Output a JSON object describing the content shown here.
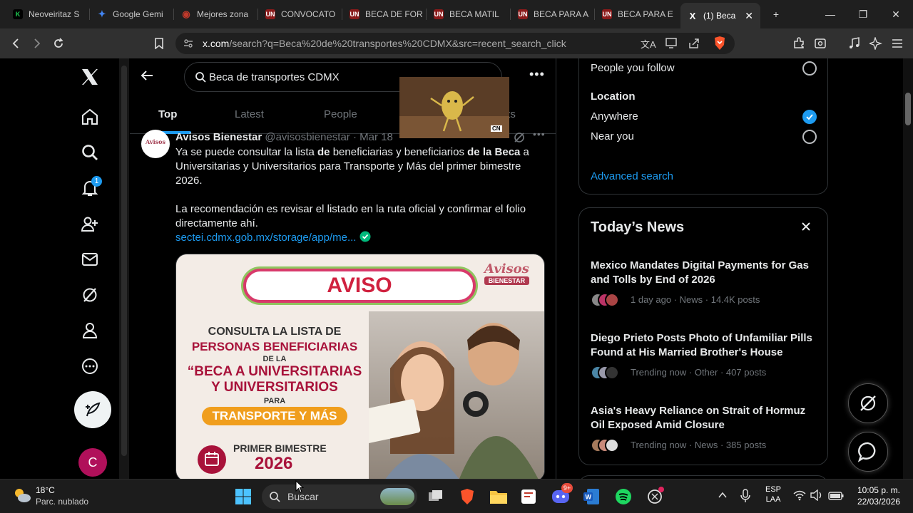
{
  "browser": {
    "tabs": [
      {
        "label": "Neoveiritaz S",
        "favicon": "K",
        "color": "#1fd155"
      },
      {
        "label": "Google Gemi",
        "favicon": "✦",
        "color": "#4285f4"
      },
      {
        "label": "Mejores zona",
        "favicon": "◉",
        "color": "#c0392b"
      },
      {
        "label": "CONVOCATO",
        "favicon": "UN",
        "color": "#8b1a1a"
      },
      {
        "label": "BECA DE FOR",
        "favicon": "UN",
        "color": "#8b1a1a"
      },
      {
        "label": "BECA MATIL",
        "favicon": "UN",
        "color": "#8b1a1a"
      },
      {
        "label": "BECA PARA A",
        "favicon": "UN",
        "color": "#8b1a1a"
      },
      {
        "label": "BECA PARA E",
        "favicon": "UN",
        "color": "#8b1a1a"
      }
    ],
    "active_tab": {
      "label": "(1) Beca",
      "favicon": "X"
    },
    "url_domain": "x.com",
    "url_path": "/search?q=Beca%20de%20transportes%20CDMX&src=recent_search_click"
  },
  "search": {
    "query": "Beca de transportes CDMX",
    "tabs": [
      "Top",
      "Latest",
      "People",
      "Lists"
    ],
    "active_tab": "Top"
  },
  "nav": {
    "notification_count": "1",
    "avatar_letter": "C"
  },
  "tweet": {
    "author": "Avisos Bienestar",
    "handle": "@avisosbienestar",
    "date": "Mar 18",
    "line1_pre": "Ya se puede consultar la lista ",
    "line1_b1": "de",
    "line1_mid": " beneficiarias y beneficiarios ",
    "line1_b2": "de",
    "line1_sp": " ",
    "line1_b3": "la",
    "line1_sp2": " ",
    "line1_b4": "Beca",
    "line1_post": " a Universitarias y Universitarios para Transporte y Más del primer bimestre 2026.",
    "para2": "La recomendación es revisar el listado en la ruta oficial y confirmar el folio directamente ahí.",
    "link": "sectei.cdmx.gob.mx/storage/app/me...",
    "image": {
      "brand_top": "Avisos",
      "brand_bottom": "BIENESTAR",
      "aviso": "AVISO",
      "consulta": "CONSULTA LA LISTA DE",
      "personas": "PERSONAS BENEFICIARIAS",
      "dela": "DE LA",
      "beca1": "“BECA A UNIVERSITARIAS",
      "beca2": "Y UNIVERSITARIOS",
      "para": "PARA",
      "transporte": "TRANSPORTE Y MÁS",
      "primer": "PRIMER BIMESTRE",
      "year": "2026"
    },
    "video_badge": "CN"
  },
  "filters": {
    "people_label": "People you follow",
    "location_heading": "Location",
    "anywhere": "Anywhere",
    "near_you": "Near you",
    "advanced": "Advanced search"
  },
  "news": {
    "heading": "Today’s News",
    "items": [
      {
        "title": "Mexico Mandates Digital Payments for Gas and Tolls by End of 2026",
        "meta": "1 day ago · News · 14.4K posts"
      },
      {
        "title": "Diego Prieto Posts Photo of Unfamiliar Pills Found at His Married Brother's House",
        "meta": "Trending now · Other · 407 posts"
      },
      {
        "title": "Asia's Heavy Reliance on Strait of Hormuz Oil Exposed Amid Closure",
        "meta": "Trending now · News · 385 posts"
      }
    ]
  },
  "taskbar": {
    "temp": "18°C",
    "weather": "Parc. nublado",
    "search": "Buscar",
    "discord_badge": "9+",
    "lang1": "ESP",
    "lang2": "LAA",
    "time": "10:05 p. m.",
    "date": "22/03/2026"
  },
  "colors": {
    "accent": "#1d9bf0",
    "verified": "#00ba7c",
    "bg": "#000000"
  }
}
